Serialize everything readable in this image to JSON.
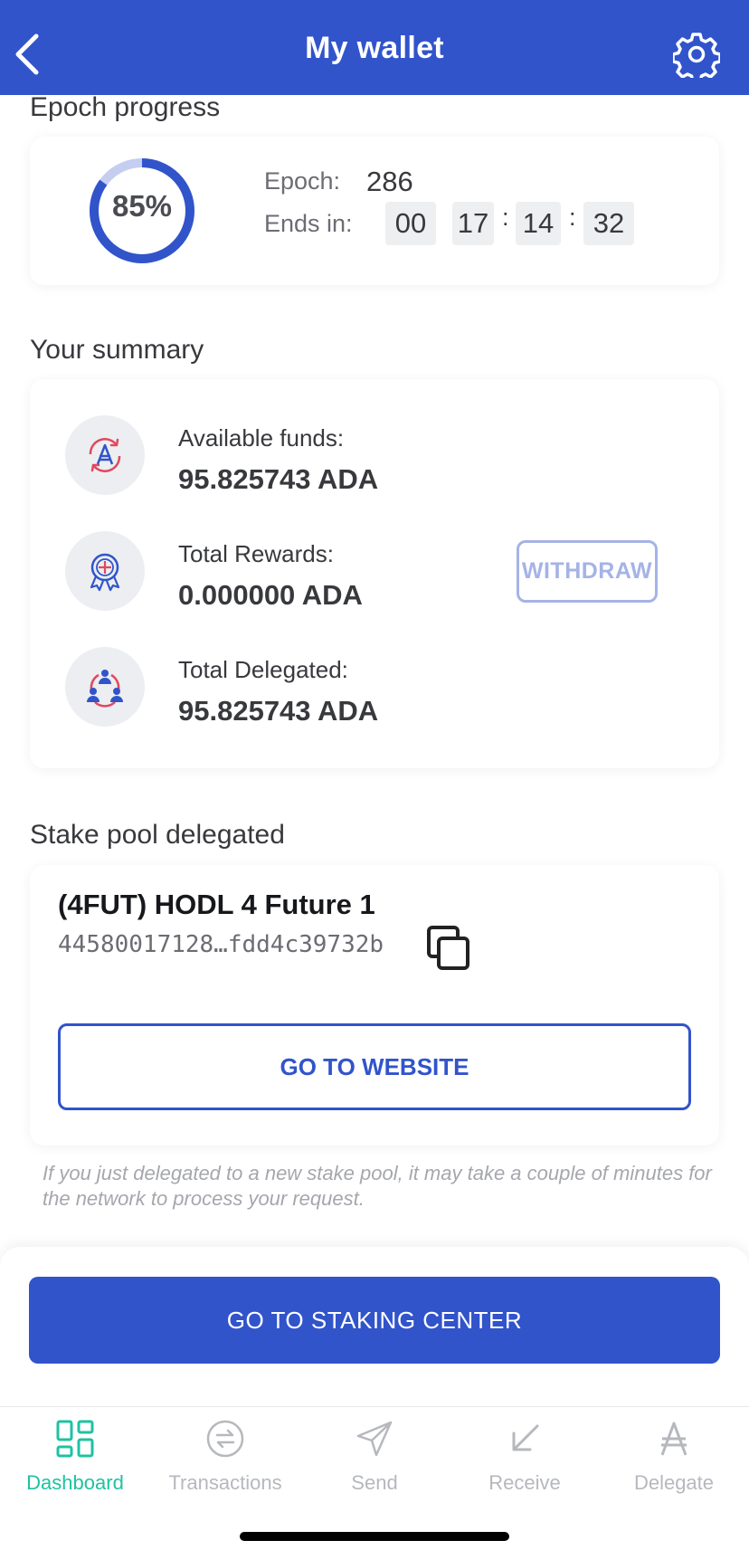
{
  "header": {
    "title": "My wallet"
  },
  "epoch": {
    "section_title": "Epoch progress",
    "progress_label": "85%",
    "progress_fraction": 0.85,
    "epoch_label": "Epoch:",
    "epoch_value": "286",
    "ends_label": "Ends in:",
    "time": [
      "00",
      "17",
      "14",
      "32"
    ]
  },
  "summary": {
    "section_title": "Your summary",
    "available_label": "Available funds:",
    "available_value": "95.825743 ADA",
    "rewards_label": "Total Rewards:",
    "rewards_value": "0.000000 ADA",
    "delegated_label": "Total Delegated:",
    "delegated_value": "95.825743 ADA",
    "withdraw_label": "WITHDRAW"
  },
  "pool": {
    "section_title": "Stake pool delegated",
    "name": "(4FUT) HODL 4 Future 1",
    "hash": "44580017128…fdd4c39732b",
    "website_button": "GO TO WEBSITE",
    "note": "If you just delegated to a new stake pool, it may take a couple of minutes for the network to process your request."
  },
  "staking_button": "GO TO STAKING CENTER",
  "nav": [
    {
      "label": "Dashboard",
      "icon": "dashboard-icon",
      "active": true
    },
    {
      "label": "Transactions",
      "icon": "transactions-icon",
      "active": false
    },
    {
      "label": "Send",
      "icon": "send-icon",
      "active": false
    },
    {
      "label": "Receive",
      "icon": "receive-icon",
      "active": false
    },
    {
      "label": "Delegate",
      "icon": "delegate-icon",
      "active": false
    }
  ],
  "colors": {
    "primary": "#3154cb",
    "active_nav": "#1fc2a2",
    "inactive_nav": "#b6b8bd",
    "withdraw_disabled": "#a5b3e6",
    "icon_red": "#e0485e",
    "icon_blue": "#3154cb"
  }
}
